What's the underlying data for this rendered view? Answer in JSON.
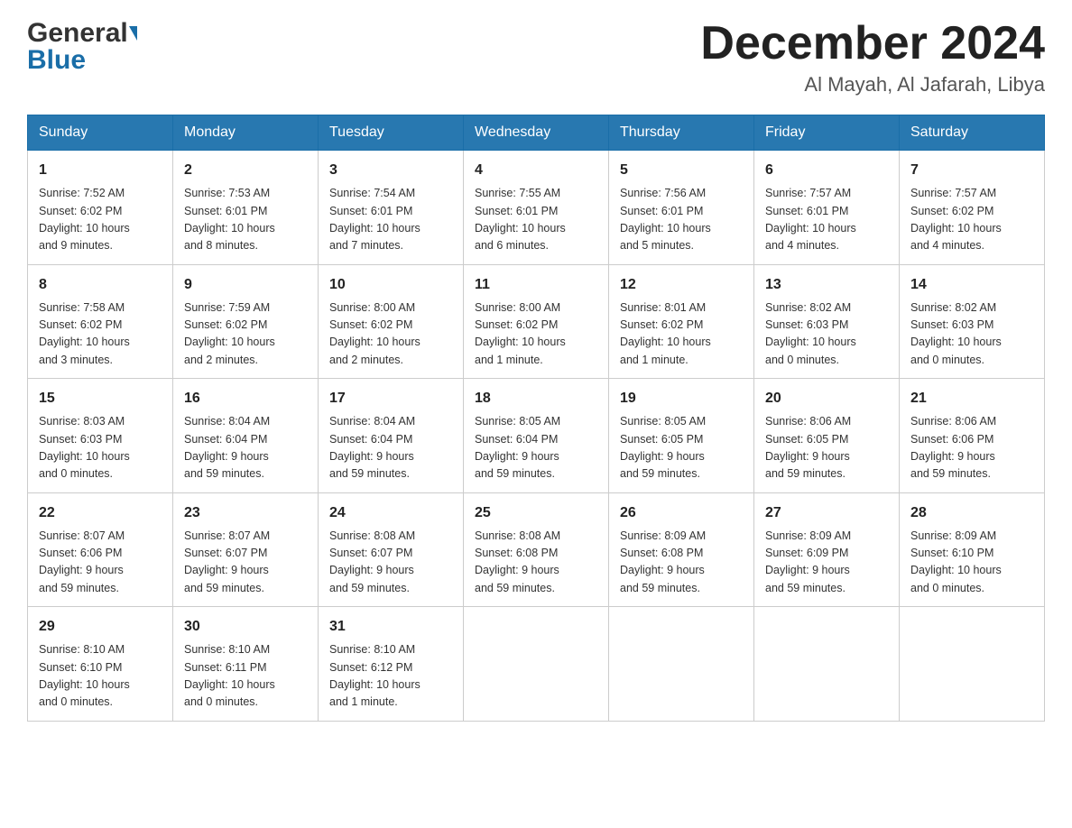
{
  "header": {
    "logo_line1": "General",
    "logo_line2": "Blue",
    "month_title": "December 2024",
    "location": "Al Mayah, Al Jafarah, Libya"
  },
  "weekdays": [
    "Sunday",
    "Monday",
    "Tuesday",
    "Wednesday",
    "Thursday",
    "Friday",
    "Saturday"
  ],
  "weeks": [
    [
      {
        "day": "1",
        "sunrise": "7:52 AM",
        "sunset": "6:02 PM",
        "daylight": "10 hours and 9 minutes."
      },
      {
        "day": "2",
        "sunrise": "7:53 AM",
        "sunset": "6:01 PM",
        "daylight": "10 hours and 8 minutes."
      },
      {
        "day": "3",
        "sunrise": "7:54 AM",
        "sunset": "6:01 PM",
        "daylight": "10 hours and 7 minutes."
      },
      {
        "day": "4",
        "sunrise": "7:55 AM",
        "sunset": "6:01 PM",
        "daylight": "10 hours and 6 minutes."
      },
      {
        "day": "5",
        "sunrise": "7:56 AM",
        "sunset": "6:01 PM",
        "daylight": "10 hours and 5 minutes."
      },
      {
        "day": "6",
        "sunrise": "7:57 AM",
        "sunset": "6:01 PM",
        "daylight": "10 hours and 4 minutes."
      },
      {
        "day": "7",
        "sunrise": "7:57 AM",
        "sunset": "6:02 PM",
        "daylight": "10 hours and 4 minutes."
      }
    ],
    [
      {
        "day": "8",
        "sunrise": "7:58 AM",
        "sunset": "6:02 PM",
        "daylight": "10 hours and 3 minutes."
      },
      {
        "day": "9",
        "sunrise": "7:59 AM",
        "sunset": "6:02 PM",
        "daylight": "10 hours and 2 minutes."
      },
      {
        "day": "10",
        "sunrise": "8:00 AM",
        "sunset": "6:02 PM",
        "daylight": "10 hours and 2 minutes."
      },
      {
        "day": "11",
        "sunrise": "8:00 AM",
        "sunset": "6:02 PM",
        "daylight": "10 hours and 1 minute."
      },
      {
        "day": "12",
        "sunrise": "8:01 AM",
        "sunset": "6:02 PM",
        "daylight": "10 hours and 1 minute."
      },
      {
        "day": "13",
        "sunrise": "8:02 AM",
        "sunset": "6:03 PM",
        "daylight": "10 hours and 0 minutes."
      },
      {
        "day": "14",
        "sunrise": "8:02 AM",
        "sunset": "6:03 PM",
        "daylight": "10 hours and 0 minutes."
      }
    ],
    [
      {
        "day": "15",
        "sunrise": "8:03 AM",
        "sunset": "6:03 PM",
        "daylight": "10 hours and 0 minutes."
      },
      {
        "day": "16",
        "sunrise": "8:04 AM",
        "sunset": "6:04 PM",
        "daylight": "9 hours and 59 minutes."
      },
      {
        "day": "17",
        "sunrise": "8:04 AM",
        "sunset": "6:04 PM",
        "daylight": "9 hours and 59 minutes."
      },
      {
        "day": "18",
        "sunrise": "8:05 AM",
        "sunset": "6:04 PM",
        "daylight": "9 hours and 59 minutes."
      },
      {
        "day": "19",
        "sunrise": "8:05 AM",
        "sunset": "6:05 PM",
        "daylight": "9 hours and 59 minutes."
      },
      {
        "day": "20",
        "sunrise": "8:06 AM",
        "sunset": "6:05 PM",
        "daylight": "9 hours and 59 minutes."
      },
      {
        "day": "21",
        "sunrise": "8:06 AM",
        "sunset": "6:06 PM",
        "daylight": "9 hours and 59 minutes."
      }
    ],
    [
      {
        "day": "22",
        "sunrise": "8:07 AM",
        "sunset": "6:06 PM",
        "daylight": "9 hours and 59 minutes."
      },
      {
        "day": "23",
        "sunrise": "8:07 AM",
        "sunset": "6:07 PM",
        "daylight": "9 hours and 59 minutes."
      },
      {
        "day": "24",
        "sunrise": "8:08 AM",
        "sunset": "6:07 PM",
        "daylight": "9 hours and 59 minutes."
      },
      {
        "day": "25",
        "sunrise": "8:08 AM",
        "sunset": "6:08 PM",
        "daylight": "9 hours and 59 minutes."
      },
      {
        "day": "26",
        "sunrise": "8:09 AM",
        "sunset": "6:08 PM",
        "daylight": "9 hours and 59 minutes."
      },
      {
        "day": "27",
        "sunrise": "8:09 AM",
        "sunset": "6:09 PM",
        "daylight": "9 hours and 59 minutes."
      },
      {
        "day": "28",
        "sunrise": "8:09 AM",
        "sunset": "6:10 PM",
        "daylight": "10 hours and 0 minutes."
      }
    ],
    [
      {
        "day": "29",
        "sunrise": "8:10 AM",
        "sunset": "6:10 PM",
        "daylight": "10 hours and 0 minutes."
      },
      {
        "day": "30",
        "sunrise": "8:10 AM",
        "sunset": "6:11 PM",
        "daylight": "10 hours and 0 minutes."
      },
      {
        "day": "31",
        "sunrise": "8:10 AM",
        "sunset": "6:12 PM",
        "daylight": "10 hours and 1 minute."
      },
      null,
      null,
      null,
      null
    ]
  ],
  "labels": {
    "sunrise": "Sunrise:",
    "sunset": "Sunset:",
    "daylight": "Daylight:"
  }
}
